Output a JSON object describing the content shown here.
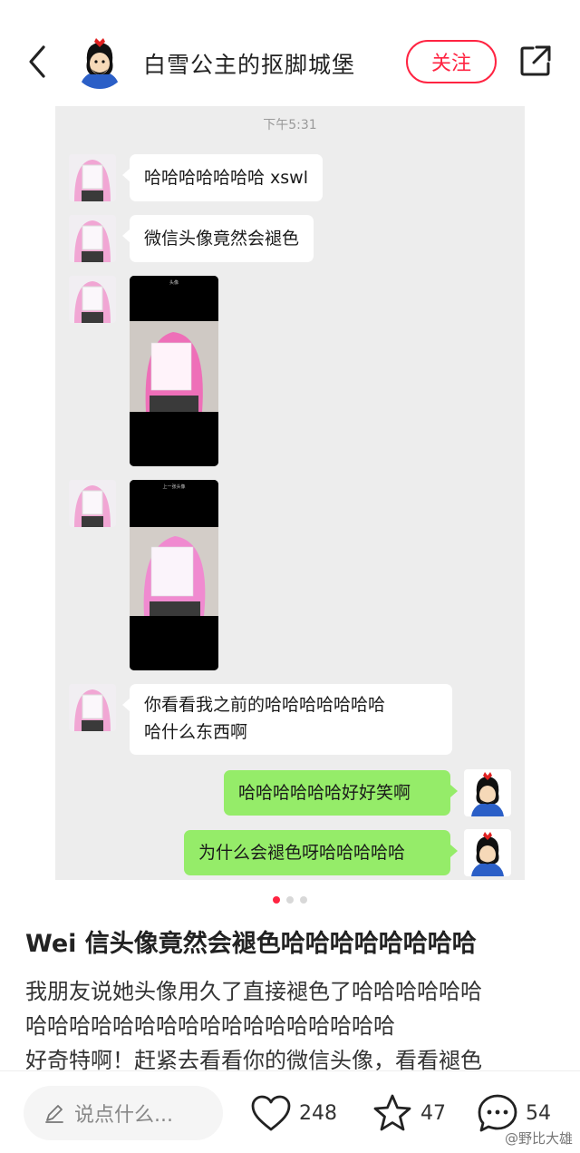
{
  "header": {
    "author_name": "白雪公主的抠脚城堡",
    "follow_label": "关注"
  },
  "chat": {
    "time": "下午5:31",
    "messages": [
      {
        "side": "left",
        "type": "text",
        "text": "哈哈哈哈哈哈哈 xswl"
      },
      {
        "side": "left",
        "type": "text",
        "text": "微信头像竟然会褪色"
      },
      {
        "side": "left",
        "type": "image",
        "caption": "头像"
      },
      {
        "side": "left",
        "type": "image",
        "caption": "上一张头像"
      },
      {
        "side": "left",
        "type": "text",
        "lines": [
          "你看看我之前的哈哈哈哈哈哈哈",
          "哈什么东西啊"
        ]
      },
      {
        "side": "right",
        "type": "text",
        "text": "哈哈哈哈哈哈好好笑啊"
      },
      {
        "side": "right",
        "type": "text",
        "text": "为什么会褪色呀哈哈哈哈哈"
      }
    ]
  },
  "carousel": {
    "total": 3,
    "active": 1
  },
  "note": {
    "title": "Wei 信头像竟然会褪色哈哈哈哈哈哈哈哈",
    "desc_lines": [
      "我朋友说她头像用久了直接褪色了哈哈哈哈哈哈",
      "哈哈哈哈哈哈哈哈哈哈哈哈哈哈哈哈哈",
      "好奇特啊！赶紧去看看你的微信头像，看看褪色"
    ]
  },
  "bottom_bar": {
    "comment_placeholder": "说点什么...",
    "likes": "248",
    "collects": "47",
    "comments": "54"
  },
  "watermark": "@野比大雄",
  "colors": {
    "accent": "#ff2442",
    "chat_bg": "#ededed",
    "self_bubble": "#95ec69"
  },
  "icons": [
    "back-chevron-icon",
    "share-icon",
    "heart-icon",
    "star-icon",
    "comment-icon",
    "pencil-icon"
  ]
}
